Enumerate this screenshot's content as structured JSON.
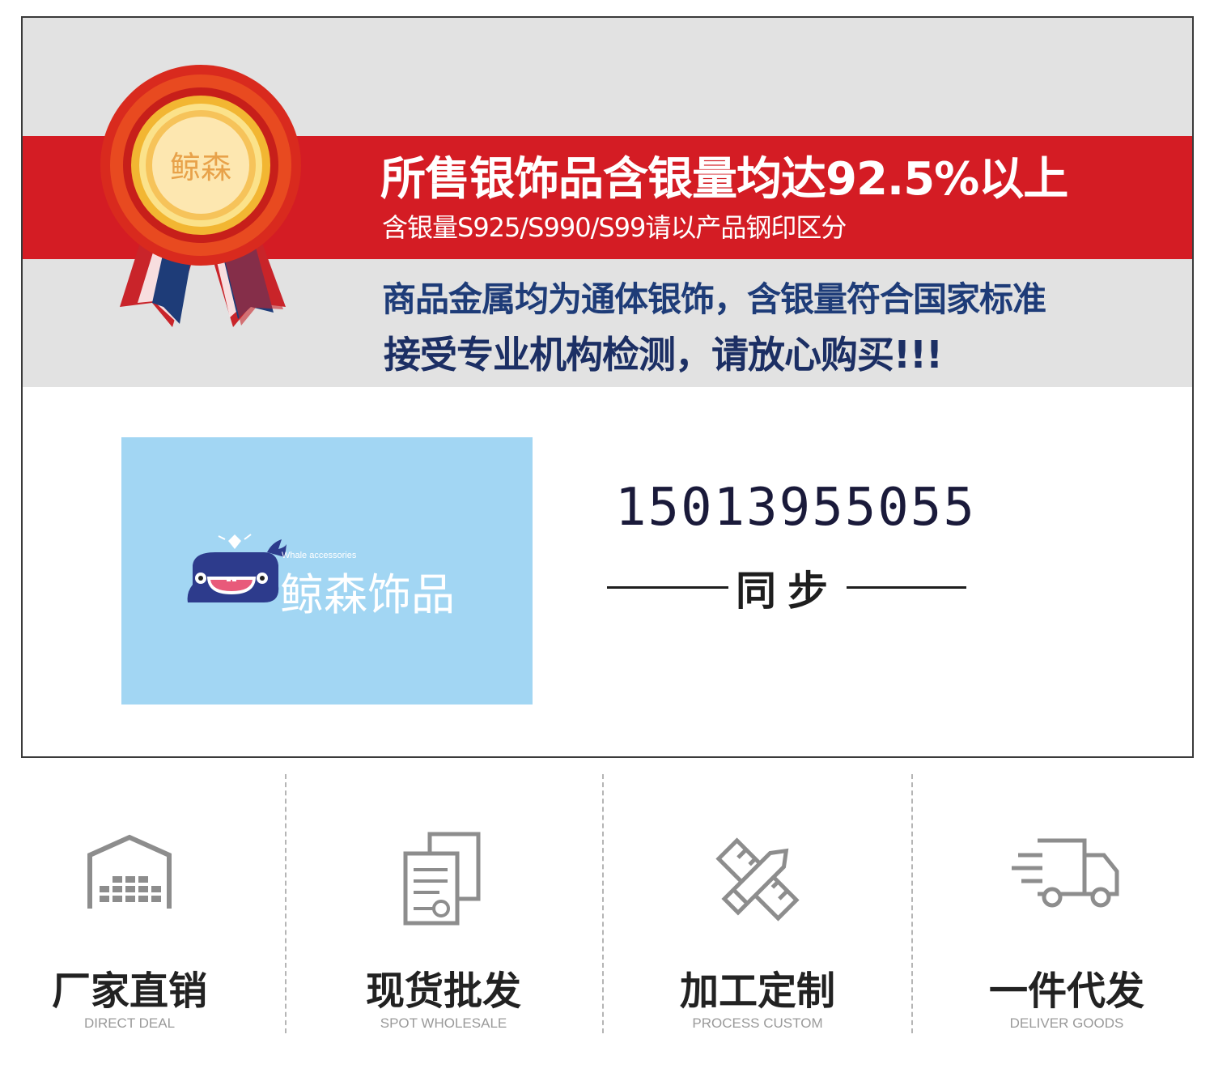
{
  "banner": {
    "headline": "所售银饰品含银量均达92.5%以上",
    "subline": "含银量S925/S990/S99请以产品钢印区分",
    "line_blue_1": "商品金属均为通体银饰，含银量符合国家标准",
    "line_blue_2": "接受专业机构检测，请放心购买!!!"
  },
  "badge": {
    "text": "鲸森"
  },
  "logo": {
    "english": "Whale accessories",
    "chinese": "鲸森饰品"
  },
  "contact": {
    "phone": "15013955055",
    "sync_label": "同步"
  },
  "features": [
    {
      "cn": "厂家直销",
      "en": "DIRECT DEAL",
      "icon": "warehouse-icon"
    },
    {
      "cn": "现货批发",
      "en": "SPOT WHOLESALE",
      "icon": "document-icon"
    },
    {
      "cn": "加工定制",
      "en": "PROCESS CUSTOM",
      "icon": "pencil-ruler-icon"
    },
    {
      "cn": "一件代发",
      "en": "DELIVER GOODS",
      "icon": "truck-icon"
    }
  ],
  "colors": {
    "red": "#d41c24",
    "navy": "#1e3c78",
    "gold": "#e8a317",
    "logo_bg": "#a2d6f3"
  }
}
